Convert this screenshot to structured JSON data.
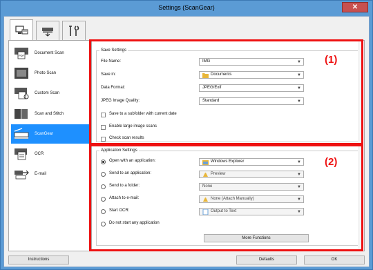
{
  "window": {
    "title": "Settings (ScanGear)",
    "close_glyph": "✕"
  },
  "tabs": [
    {
      "icon": "scan-from-computer-icon",
      "active": true
    },
    {
      "icon": "scan-from-panel-icon",
      "active": false
    },
    {
      "icon": "general-settings-icon",
      "active": false
    }
  ],
  "sidebar": {
    "items": [
      {
        "label": "Document Scan",
        "icon": "document-scan-icon"
      },
      {
        "label": "Photo Scan",
        "icon": "photo-scan-icon"
      },
      {
        "label": "Custom Scan",
        "icon": "custom-scan-icon"
      },
      {
        "label": "Scan and Stitch",
        "icon": "scan-and-stitch-icon"
      },
      {
        "label": "ScanGear",
        "icon": "scangear-icon",
        "active": true
      },
      {
        "label": "OCR",
        "icon": "ocr-icon"
      },
      {
        "label": "E-mail",
        "icon": "email-icon"
      }
    ]
  },
  "save_settings": {
    "title": "Save Settings",
    "file_name_label": "File Name:",
    "file_name_value": "IMG",
    "save_in_label": "Save in:",
    "save_in_value": "Documents",
    "data_format_label": "Data Format:",
    "data_format_value": "JPEG/Exif",
    "jpeg_quality_label": "JPEG Image Quality:",
    "jpeg_quality_value": "Standard",
    "subfolder_label": "Save to a subfolder with current date",
    "large_scans_label": "Enable large image scans",
    "check_results_label": "Check scan results"
  },
  "app_settings": {
    "title": "Application Settings",
    "open_app_label": "Open with an application:",
    "open_app_value": "Windows Explorer",
    "send_app_label": "Send to an application:",
    "send_app_value": "Preview",
    "send_folder_label": "Send to a folder:",
    "send_folder_value": "None",
    "attach_email_label": "Attach to e-mail:",
    "attach_email_value": "None (Attach Manually)",
    "start_ocr_label": "Start OCR:",
    "start_ocr_value": "Output to Text",
    "no_app_label": "Do not start any application",
    "more_functions": "More Functions"
  },
  "callouts": {
    "one": "(1)",
    "two": "(2)"
  },
  "bottom": {
    "instructions": "Instructions",
    "defaults": "Defaults",
    "ok": "OK"
  },
  "colors": {
    "highlight": "#e11111",
    "active_item": "#1e90ff",
    "title_bar": "#5b9bd5"
  }
}
